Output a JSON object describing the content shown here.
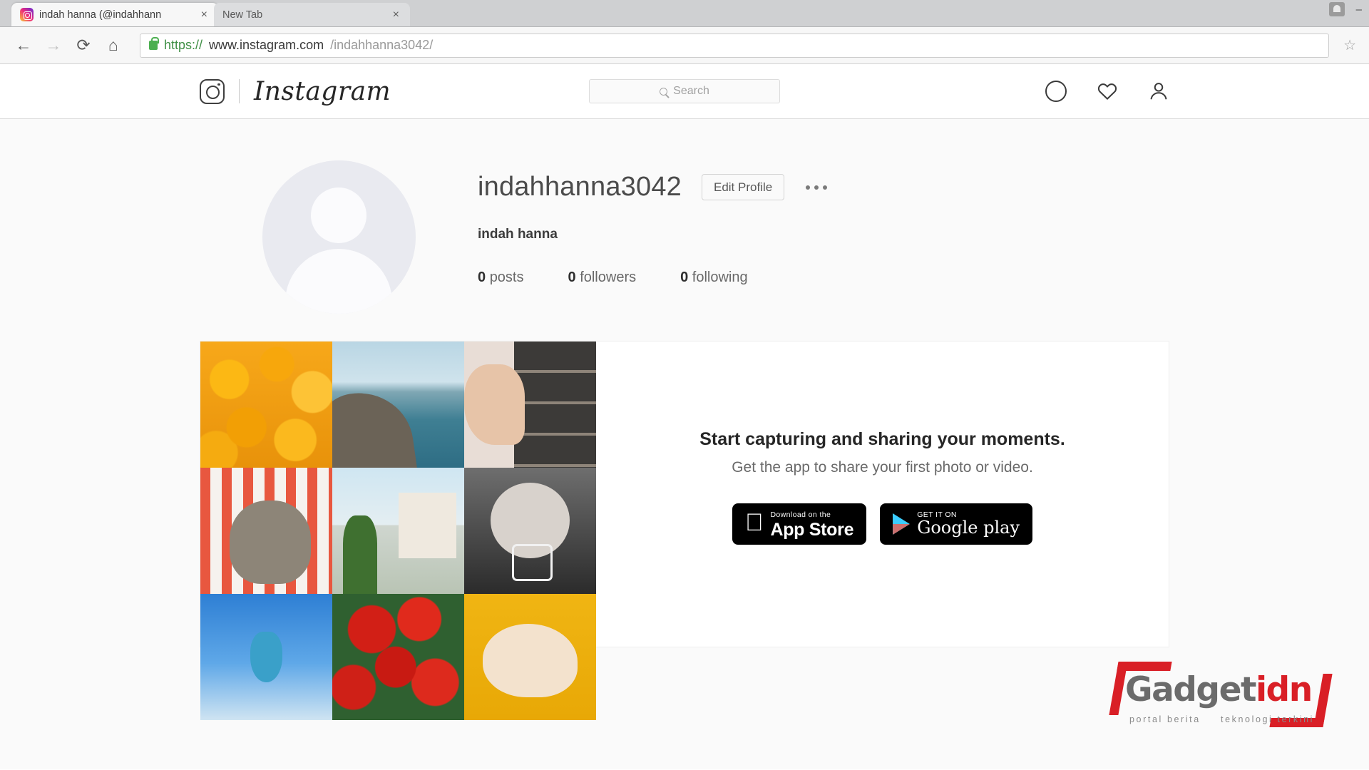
{
  "browser": {
    "tabs": [
      {
        "title": "indah hanna (@indahhann",
        "favicon": "instagram-favicon",
        "close": "×",
        "active": true
      },
      {
        "title": "New Tab",
        "favicon": "none",
        "close": "×",
        "active": false
      }
    ],
    "window_controls": {
      "user": "user-avatar-button",
      "minimize": "–",
      "maximize": "□",
      "close": "×"
    },
    "toolbar": {
      "back": "←",
      "forward": "→",
      "reload": "⟳",
      "home": "⌂",
      "bookmark": "☆",
      "url_scheme": "https://",
      "url_domain": "www.instagram.com",
      "url_path": "/indahhanna3042/",
      "full_url": "https://www.instagram.com/indahhanna3042/",
      "secure_label": "Secure"
    }
  },
  "instagram": {
    "nav": {
      "brand": "Instagram",
      "search_placeholder": "Search",
      "search_value": "",
      "icons": [
        "explore-compass-icon",
        "activity-heart-icon",
        "profile-person-icon"
      ]
    },
    "profile": {
      "username": "indahhanna3042",
      "edit_button": "Edit Profile",
      "options_button": "•••",
      "full_name": "indah hanna",
      "stats": [
        {
          "count": "0",
          "label": "posts"
        },
        {
          "count": "0",
          "label": "followers"
        },
        {
          "count": "0",
          "label": "following"
        }
      ]
    },
    "promo": {
      "title": "Start capturing and sharing your moments.",
      "subtitle": "Get the app to share your first photo or video.",
      "badges": [
        {
          "small": "Download on the",
          "large": "App Store",
          "icon": "apple-logo-icon"
        },
        {
          "small": "GET IT ON",
          "large": "Google play",
          "icon": "google-play-icon"
        }
      ],
      "grid_tiles": [
        "oranges-photo",
        "coastline-photo",
        "photobooth-strip-photo",
        "dog-on-blanket-photo",
        "cactus-building-photo",
        "crying-baby-photo",
        "blue-sky-photo",
        "red-flowers-photo",
        "sleeping-cat-photo"
      ]
    }
  },
  "watermark": {
    "brand_first": "Gadget",
    "brand_second": "idn",
    "tagline_left": "portal berita",
    "tagline_right": "teknologi terkini"
  }
}
